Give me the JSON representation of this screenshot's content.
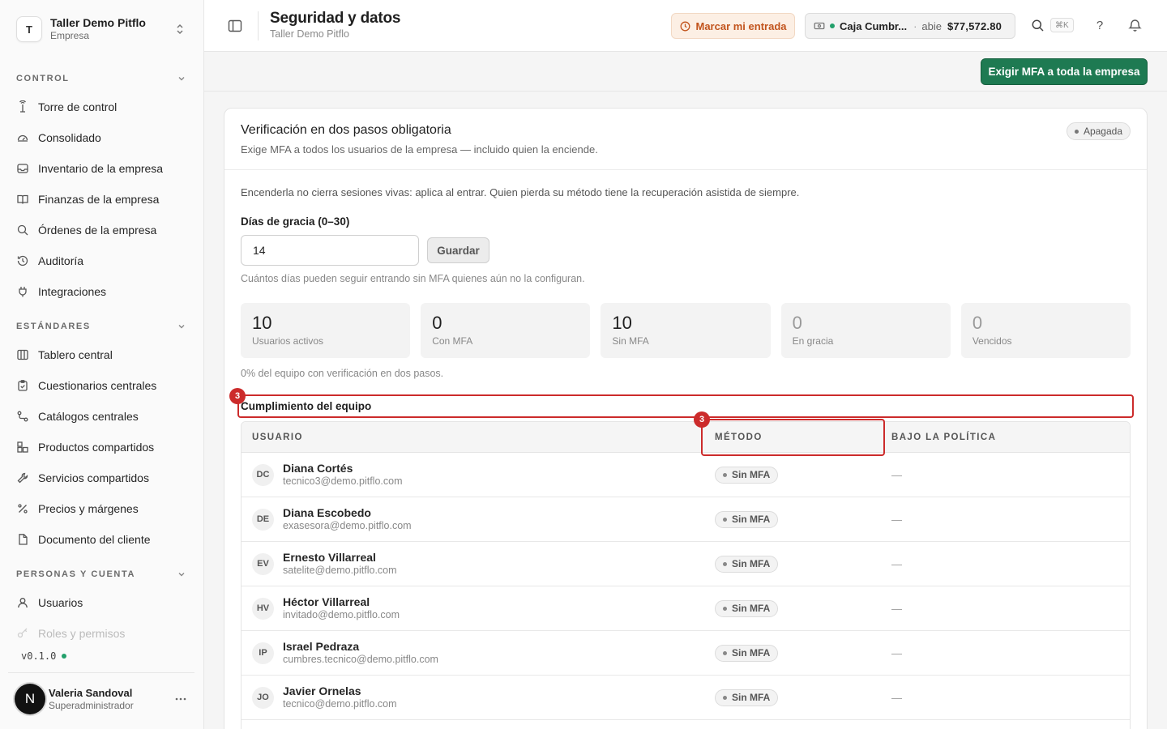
{
  "workspace": {
    "initial": "T",
    "name": "Taller Demo Pitflo",
    "type": "Empresa"
  },
  "sidebar": {
    "sections": [
      {
        "title": "CONTROL",
        "items": [
          {
            "label": "Torre de control",
            "icon": "tower-icon"
          },
          {
            "label": "Consolidado",
            "icon": "gauge-icon"
          },
          {
            "label": "Inventario de la empresa",
            "icon": "inbox-icon"
          },
          {
            "label": "Finanzas de la empresa",
            "icon": "book-icon"
          },
          {
            "label": "Órdenes de la empresa",
            "icon": "search-icon"
          },
          {
            "label": "Auditoría",
            "icon": "history-icon"
          },
          {
            "label": "Integraciones",
            "icon": "plug-icon"
          }
        ]
      },
      {
        "title": "ESTÁNDARES",
        "items": [
          {
            "label": "Tablero central",
            "icon": "columns-icon"
          },
          {
            "label": "Cuestionarios centrales",
            "icon": "clipboard-icon"
          },
          {
            "label": "Catálogos centrales",
            "icon": "route-icon"
          },
          {
            "label": "Productos compartidos",
            "icon": "boxes-icon"
          },
          {
            "label": "Servicios compartidos",
            "icon": "wrench-icon"
          },
          {
            "label": "Precios y márgenes",
            "icon": "percent-icon"
          },
          {
            "label": "Documento del cliente",
            "icon": "file-icon"
          }
        ]
      },
      {
        "title": "PERSONAS Y CUENTA",
        "items": [
          {
            "label": "Usuarios",
            "icon": "user-icon"
          },
          {
            "label": "Roles y permisos",
            "icon": "key-icon"
          }
        ]
      }
    ],
    "version": "v0.1.0"
  },
  "current_user": {
    "initial": "N",
    "name": "Valeria Sandoval",
    "role": "Superadministrador"
  },
  "header": {
    "title": "Seguridad y datos",
    "subtitle": "Taller Demo Pitflo",
    "clock_in_label": "Marcar mi entrada",
    "register": {
      "name": "Caja Cumbr...",
      "separator": "·",
      "status": "abie",
      "amount": "$77,572.80"
    },
    "shortcut": "⌘K",
    "help": "?"
  },
  "actions": {
    "enforce_label": "Exigir MFA a toda la empresa"
  },
  "mfa_card": {
    "title": "Verificación en dos pasos obligatoria",
    "description": "Exige MFA a todos los usuarios de la empresa — incluido quien la enciende.",
    "status": "Apagada",
    "note": "Encenderla no cierra sesiones vivas: aplica al entrar. Quien pierda su método tiene la recuperación asistida de siempre.",
    "grace_label": "Días de gracia (0–30)",
    "grace_value": "14",
    "save_label": "Guardar",
    "grace_help": "Cuántos días pueden seguir entrando sin MFA quienes aún no la configuran.",
    "stats": [
      {
        "value": "10",
        "label": "Usuarios activos"
      },
      {
        "value": "0",
        "label": "Con MFA"
      },
      {
        "value": "10",
        "label": "Sin MFA"
      },
      {
        "value": "0",
        "label": "En gracia"
      },
      {
        "value": "0",
        "label": "Vencidos"
      }
    ],
    "coverage": "0% del equipo con verificación en dos pasos."
  },
  "compliance": {
    "title": "Cumplimiento del equipo",
    "highlight_number": "3",
    "columns": {
      "user": "USUARIO",
      "method": "MÉTODO",
      "policy": "BAJO LA POLÍTICA"
    },
    "rows": [
      {
        "initials": "DC",
        "name": "Diana Cortés",
        "email": "tecnico3@demo.pitflo.com",
        "method": "Sin MFA",
        "policy": "—"
      },
      {
        "initials": "DE",
        "name": "Diana Escobedo",
        "email": "exasesora@demo.pitflo.com",
        "method": "Sin MFA",
        "policy": "—"
      },
      {
        "initials": "EV",
        "name": "Ernesto Villarreal",
        "email": "satelite@demo.pitflo.com",
        "method": "Sin MFA",
        "policy": "—"
      },
      {
        "initials": "HV",
        "name": "Héctor Villarreal",
        "email": "invitado@demo.pitflo.com",
        "method": "Sin MFA",
        "policy": "—"
      },
      {
        "initials": "IP",
        "name": "Israel Pedraza",
        "email": "cumbres.tecnico@demo.pitflo.com",
        "method": "Sin MFA",
        "policy": "—"
      },
      {
        "initials": "JO",
        "name": "Javier Ornelas",
        "email": "tecnico@demo.pitflo.com",
        "method": "Sin MFA",
        "policy": "—"
      }
    ]
  },
  "colors": {
    "primary": "#1e7a52",
    "highlight": "#cc2b2b",
    "clock_bg": "#fcefe4",
    "clock_text": "#c2541d",
    "live": "#22a06b"
  }
}
